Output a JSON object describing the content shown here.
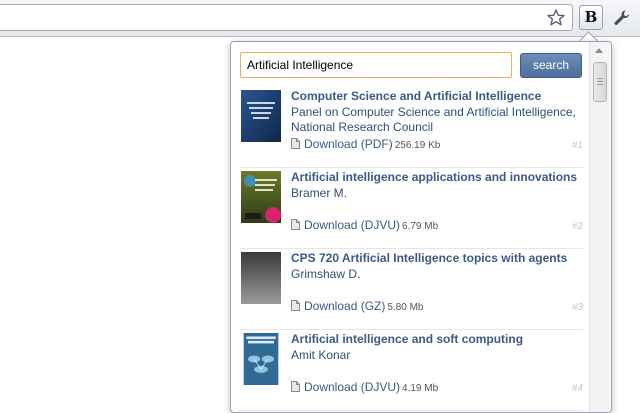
{
  "browser": {
    "extension_letter": "B",
    "icons": {
      "bookmark": "star-icon",
      "settings": "wrench-icon"
    }
  },
  "popup": {
    "search": {
      "value": "Artificial Intelligence",
      "button_label": "search"
    },
    "results": [
      {
        "title": "Computer Science and Artificial Intelligence",
        "author": "Panel on Computer Science and Artificial Intelligence, National Research Council",
        "download_label": "Download (PDF)",
        "size": "256.19 Kb",
        "number": "#1"
      },
      {
        "title": "Artificial intelligence applications and innovations",
        "author": "Bramer M.",
        "download_label": "Download (DJVU)",
        "size": "6.79 Mb",
        "number": "#2"
      },
      {
        "title": "CPS 720 Artificial Intelligence topics with agents",
        "author": "Grimshaw D.",
        "download_label": "Download (GZ)",
        "size": "5.80 Mb",
        "number": "#3"
      },
      {
        "title": "Artificial intelligence and soft computing",
        "author": "Amit Konar",
        "download_label": "Download (DJVU)",
        "size": "4.19 Mb",
        "number": "#4"
      }
    ]
  },
  "colors": {
    "link": "#3b5a86",
    "accent_button": "#5a7dab",
    "input_focus_border": "#e3b552"
  }
}
